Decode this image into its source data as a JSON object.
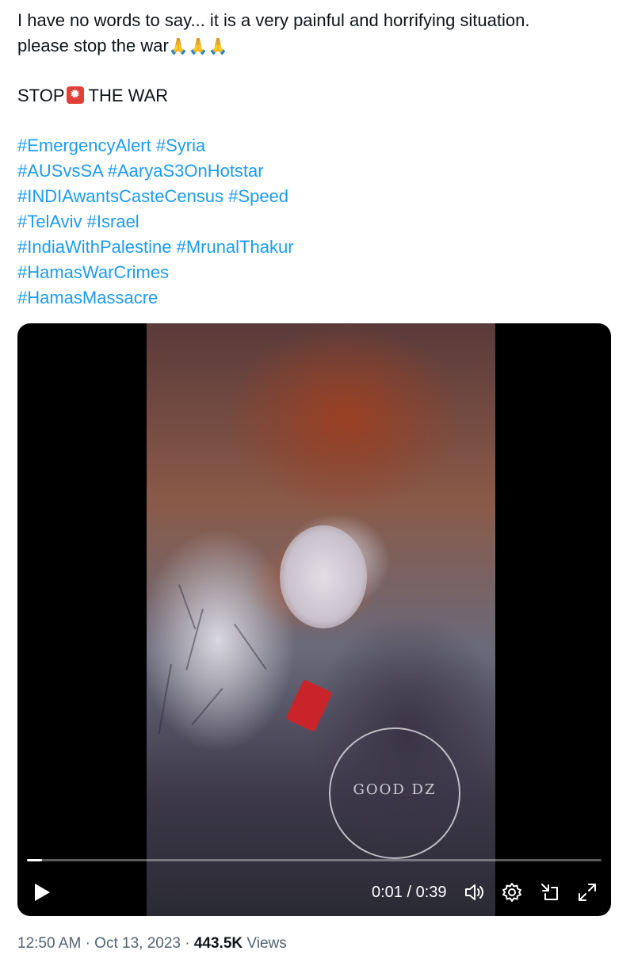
{
  "tweet": {
    "line1": "I have no words to say... it is a very painful and horrifying situation.",
    "line2": "please stop the war",
    "line2_emoji": "🙏🙏🙏",
    "stop_left": "STOP",
    "stop_emoji": "siren-emoji",
    "stop_right": "THE WAR",
    "hashtags": [
      "#EmergencyAlert",
      "#Syria",
      "#AUSvsSA",
      "#AaryaS3OnHotstar",
      "#INDIAwantsCasteCensus",
      "#Speed",
      "#TelAviv",
      "#Israel",
      "#IndiaWithPalestine",
      "#MrunalThakur",
      "#HamasWarCrimes",
      "#HamasMassacre"
    ]
  },
  "video": {
    "watermark": "GOOD DZ",
    "current_time": "0:01",
    "separator": "/",
    "duration": "0:39",
    "progress": 0.026,
    "icons": [
      "play-icon",
      "volume-icon",
      "settings-icon",
      "dock-icon",
      "fullscreen-icon"
    ]
  },
  "meta": {
    "time": "12:50 AM",
    "dot": "·",
    "date": "Oct 13, 2023",
    "views_count": "443.5K",
    "views_label": "Views"
  },
  "colors": {
    "link": "#1d9bf0",
    "text": "#0f1419",
    "muted": "#536471"
  }
}
